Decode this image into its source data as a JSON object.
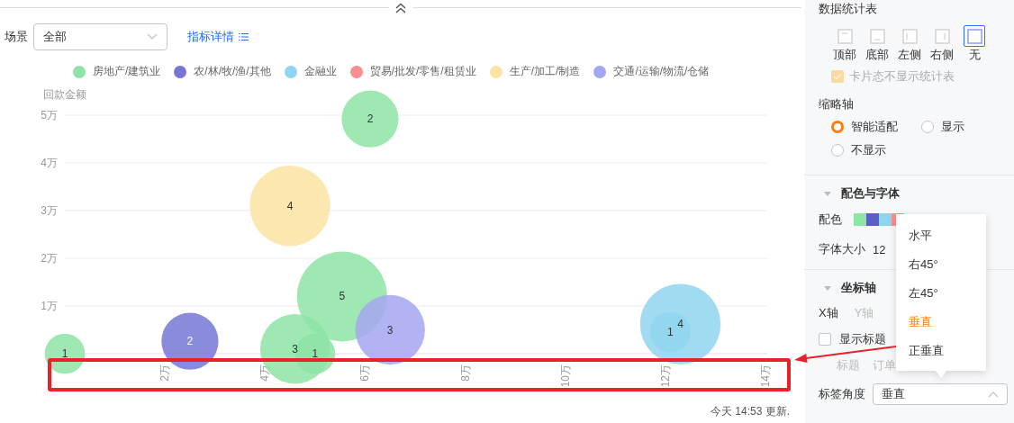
{
  "filter": {
    "label": "场景",
    "value": "全部"
  },
  "details_link": "指标详情",
  "chart": {
    "chart_data": {
      "type": "scatter",
      "ylabel": "回款金额",
      "xlim": [
        0,
        14
      ],
      "ylim": [
        0,
        5
      ],
      "xticks": [
        {
          "value": 2,
          "label": "2万"
        },
        {
          "value": 4,
          "label": "4万"
        },
        {
          "value": 6,
          "label": "6万"
        },
        {
          "value": 8,
          "label": "8万"
        },
        {
          "value": 10,
          "label": "10万"
        },
        {
          "value": 12,
          "label": "12万"
        },
        {
          "value": 14,
          "label": "14万"
        }
      ],
      "yticks": [
        {
          "value": 1,
          "label": "1万"
        },
        {
          "value": 2,
          "label": "2万"
        },
        {
          "value": 3,
          "label": "3万"
        },
        {
          "value": 4,
          "label": "4万"
        },
        {
          "value": 5,
          "label": "5万"
        }
      ],
      "grid": true,
      "data_labels": "value_labels",
      "series": [
        {
          "name": "房地产/建筑业",
          "color": "#8ee3a6",
          "x": [
            0,
            6.1,
            5.54,
            4.6,
            5.0
          ],
          "values": [
            0,
            4.92,
            1.2,
            0.1,
            0
          ],
          "sizes": [
            1,
            2,
            5,
            3,
            1
          ],
          "value_labels": [
            "1",
            "2",
            "5",
            "3",
            "1"
          ]
        },
        {
          "name": "农/林/牧/渔/其他",
          "color": "#7577d3",
          "x": [
            2.5
          ],
          "values": [
            0.26
          ],
          "sizes": [
            2
          ],
          "value_labels": [
            "2"
          ]
        },
        {
          "name": "金融业",
          "color": "#8fd5f0",
          "x": [
            12.3,
            12.1
          ],
          "values": [
            0.62,
            0.45
          ],
          "sizes": [
            4,
            1
          ],
          "value_labels": [
            "4",
            "1"
          ]
        },
        {
          "name": "贸易/批发/零售/租赁业",
          "color": "#fa8f8f"
        },
        {
          "name": "生产/加工/制造",
          "color": "#fde3a3",
          "x": [
            4.5
          ],
          "values": [
            3.1
          ],
          "sizes": [
            4
          ],
          "value_labels": [
            "4"
          ]
        },
        {
          "name": "交通/运输/物流/仓储",
          "color": "#a5a6f0",
          "x": [
            6.5
          ],
          "values": [
            0.5
          ],
          "sizes": [
            3
          ],
          "value_labels": [
            "3"
          ]
        }
      ]
    }
  },
  "footer": "今天 14:53 更新.",
  "panel": {
    "stats_table": {
      "title": "数据统计表",
      "positions": [
        {
          "label": "顶部",
          "kind": "top",
          "selected": false
        },
        {
          "label": "底部",
          "kind": "bottom",
          "selected": false
        },
        {
          "label": "左侧",
          "kind": "left",
          "selected": false
        },
        {
          "label": "右侧",
          "kind": "right",
          "selected": false
        },
        {
          "label": "无",
          "kind": "none",
          "selected": true
        }
      ],
      "card_option": {
        "label": "卡片态不显示统计表",
        "checked": true,
        "disabled": true
      }
    },
    "thumbnail_axis": {
      "title": "缩略轴",
      "options": [
        {
          "label": "智能适配",
          "selected": true
        },
        {
          "label": "显示",
          "selected": false
        },
        {
          "label": "不显示",
          "selected": false
        }
      ]
    },
    "color_font": {
      "title": "配色与字体",
      "expanded": true,
      "palette_label": "配色",
      "palette": [
        {
          "color": "#8ee3a6"
        },
        {
          "color": "#5b5fc7"
        },
        {
          "color": "#8fd5f0"
        },
        {
          "color": "#fa8f8f"
        }
      ],
      "font_size_label": "字体大小",
      "font_size": "12"
    },
    "axis": {
      "title": "坐标轴",
      "expanded": true,
      "tabs": [
        {
          "label": "X轴",
          "selected": true
        },
        {
          "label": "Y轴",
          "selected": false
        }
      ],
      "show_title": {
        "label": "显示标题",
        "checked": false
      },
      "title_label": "标题",
      "title_value": "订单",
      "label_angle": {
        "label": "标签角度",
        "value": "垂直",
        "open": true
      }
    }
  },
  "dropdown": {
    "options": [
      {
        "label": "水平",
        "selected": false
      },
      {
        "label": "右45°",
        "selected": false
      },
      {
        "label": "左45°",
        "selected": false
      },
      {
        "label": "垂直",
        "selected": true
      },
      {
        "label": "正垂直",
        "selected": false
      }
    ]
  }
}
